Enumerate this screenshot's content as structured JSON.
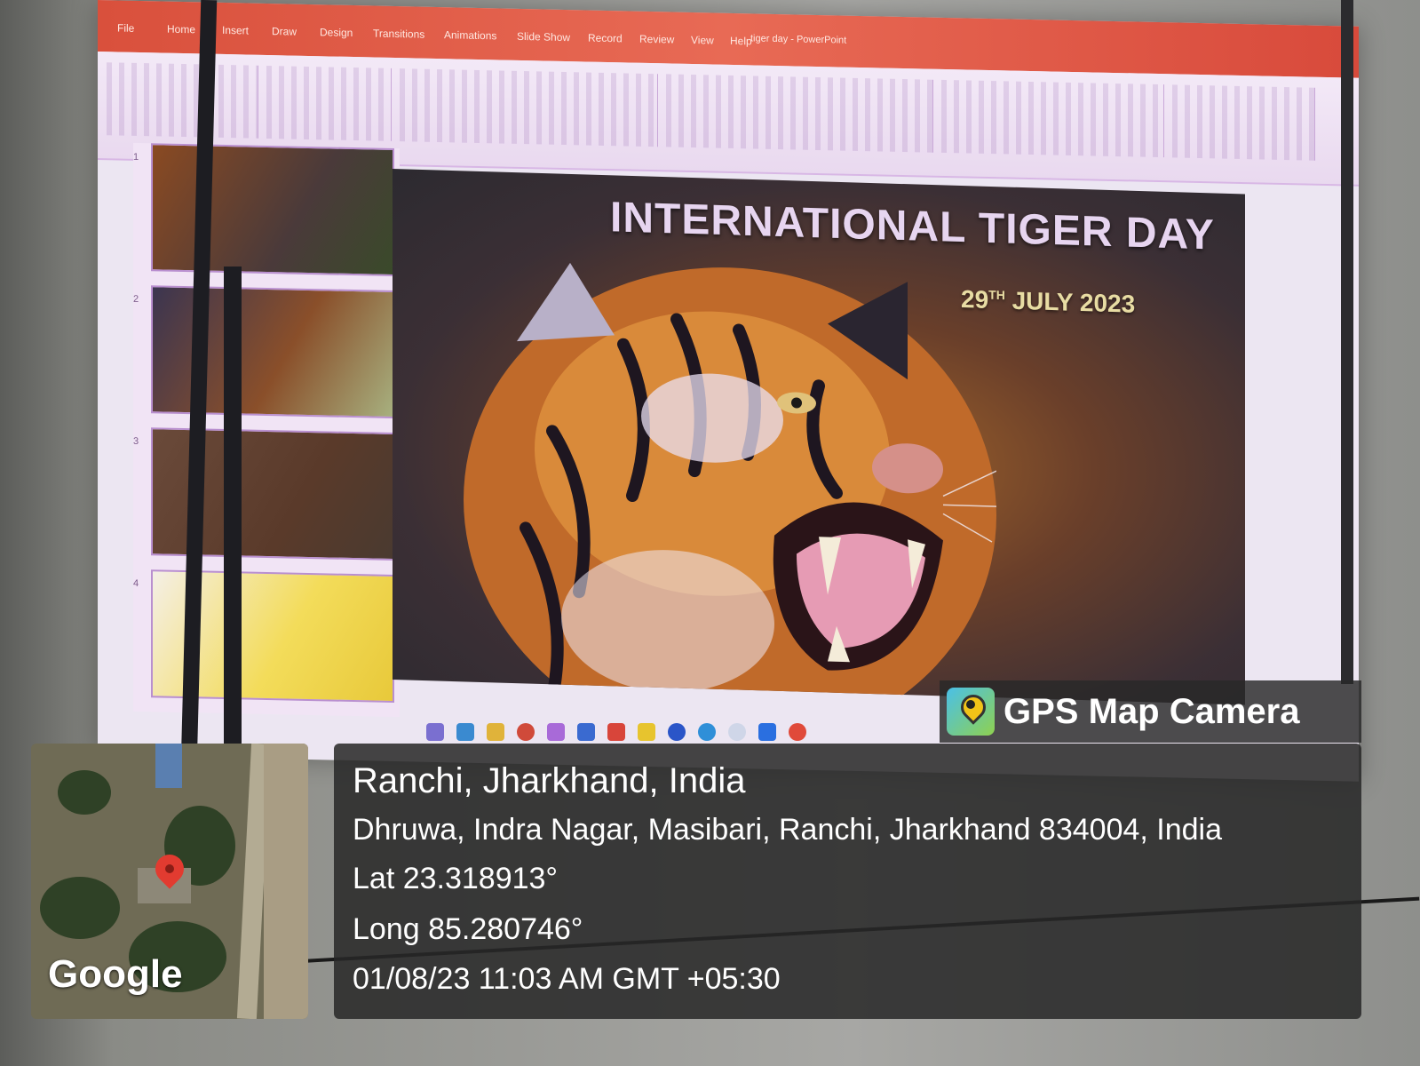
{
  "slide": {
    "title": "INTERNATIONAL TIGER DAY",
    "date_day": "29",
    "date_suffix": "TH",
    "date_rest": "JULY 2023"
  },
  "powerpoint": {
    "tabs": [
      "File",
      "Home",
      "Insert",
      "Draw",
      "Design",
      "Transitions",
      "Animations",
      "Slide Show",
      "Record",
      "Review",
      "View",
      "Help"
    ],
    "document_title": "tiger day - PowerPoint",
    "thumbnail_numbers": [
      "1",
      "2",
      "3",
      "4"
    ]
  },
  "gps": {
    "brand": "GPS Map Camera",
    "map_label": "Google",
    "location": "Ranchi, Jharkhand, India",
    "address": "Dhruwa, Indra Nagar, Masibari, Ranchi, Jharkhand 834004, India",
    "latitude": "Lat 23.318913°",
    "longitude": "Long 85.280746°",
    "timestamp": "01/08/23 11:03 AM GMT +05:30"
  },
  "colors": {
    "ribbon": "#e25a46",
    "overlay": "#282828",
    "pin": "#e23b30"
  }
}
